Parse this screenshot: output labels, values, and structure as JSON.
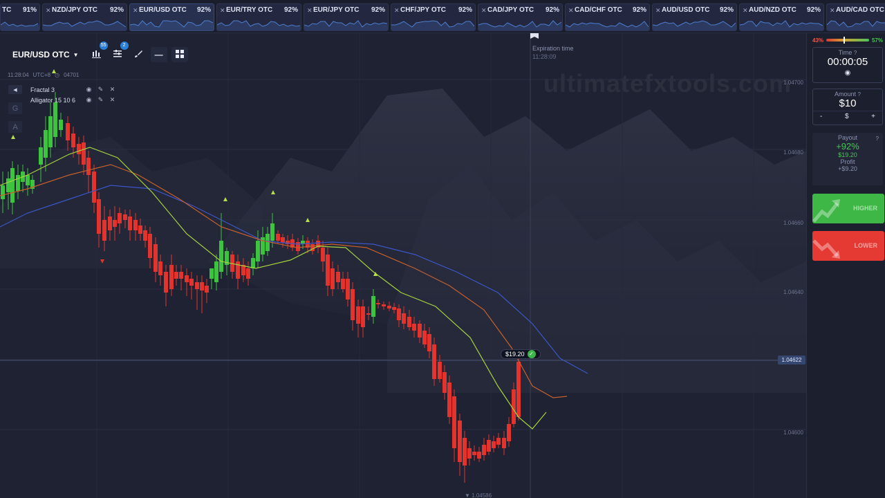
{
  "asset_tabs": [
    {
      "name": "TC",
      "pct": "91%",
      "close": false
    },
    {
      "name": "NZD/JPY OTC",
      "pct": "92%",
      "close": true
    },
    {
      "name": "EUR/USD OTC",
      "pct": "92%",
      "close": true,
      "active": true
    },
    {
      "name": "EUR/TRY OTC",
      "pct": "92%",
      "close": true
    },
    {
      "name": "EUR/JPY OTC",
      "pct": "92%",
      "close": true
    },
    {
      "name": "CHF/JPY OTC",
      "pct": "92%",
      "close": true
    },
    {
      "name": "CAD/JPY OTC",
      "pct": "92%",
      "close": true
    },
    {
      "name": "CAD/CHF OTC",
      "pct": "92%",
      "close": true
    },
    {
      "name": "AUD/USD OTC",
      "pct": "92%",
      "close": true
    },
    {
      "name": "AUD/NZD OTC",
      "pct": "92%",
      "close": true
    },
    {
      "name": "AUD/CAD OTC",
      "pct": "",
      "close": true
    }
  ],
  "toolbar": {
    "asset": "EUR/USD OTC",
    "indicators_badge": "55",
    "settings_badge": "2"
  },
  "time_info": {
    "time": "11:28:04",
    "tz": "UTC+8",
    "price": "04701"
  },
  "indicators": [
    {
      "name": "Fractal 3"
    },
    {
      "name": "Alligator 15 10 6"
    }
  ],
  "side_tools": [
    "G",
    "A"
  ],
  "expiration": {
    "label": "Expiration time",
    "time": "11:28:09"
  },
  "watermark": "ultimatefxtools.com",
  "price_axis": [
    "1.04700",
    "1.04680",
    "1.04660",
    "1.04640",
    "1.04600"
  ],
  "current_price": "1.04622",
  "low_price": "1.04586",
  "trade_marker": {
    "amount": "$19.20"
  },
  "panel": {
    "sentiment_low": "43%",
    "sentiment_high": "57%",
    "time_label": "Time",
    "time_value": "00:00:05",
    "amount_label": "Amount",
    "amount_value": "$10",
    "minus": "-",
    "currency": "$",
    "plus": "+",
    "payout_label": "Payout",
    "payout_pct": "+92%",
    "payout_amount": "$19.20",
    "profit_label": "Profit",
    "profit_value": "+$9.20",
    "higher_label": "HIGHER",
    "lower_label": "LOWER"
  },
  "colors": {
    "bull": "#3cc43f",
    "bear": "#e2342c",
    "jaw": "#3c56c8",
    "teeth": "#c8602c",
    "lips": "#a8d43c"
  }
}
